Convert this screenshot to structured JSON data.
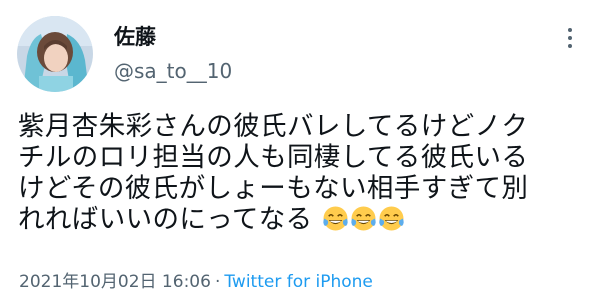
{
  "author": {
    "display_name": "佐藤",
    "handle": "@sa_to__10"
  },
  "tweet": {
    "lines": [
      "紫月杏朱彩さんの彼氏バレしてるけどノク",
      "チルのロリ担当の人も同棲してる彼氏いる",
      "けどその彼氏がしょーもない相手すぎて別",
      "れればいいのにってなる"
    ],
    "trailing_emoji": [
      "face-with-tears-of-joy",
      "face-with-tears-of-joy",
      "face-with-tears-of-joy"
    ]
  },
  "meta": {
    "timestamp": "2021年10月02日 16:06",
    "separator": "·",
    "source": "Twitter for iPhone"
  },
  "icons": {
    "more": "more-vertical-dots-icon"
  },
  "colors": {
    "text": "#0f1419",
    "secondary": "#536471",
    "link": "#1d9bf0",
    "emoji": "#ffcc4d"
  }
}
